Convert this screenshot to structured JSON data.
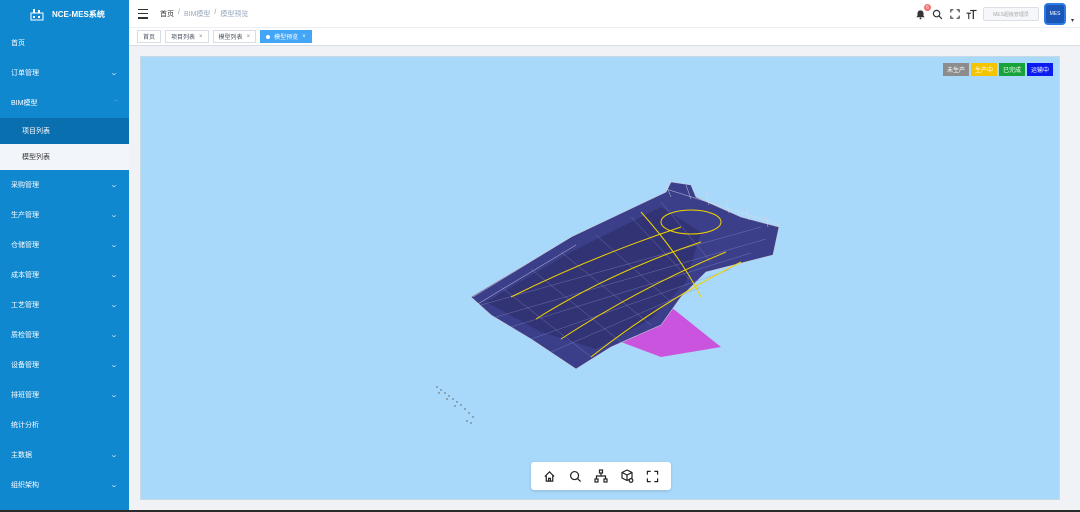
{
  "app": {
    "title": "NCE-MES系统"
  },
  "sidebar": {
    "items": [
      {
        "label": "首页",
        "has_children": false
      },
      {
        "label": "订单管理",
        "has_children": true
      },
      {
        "label": "BIM模型",
        "has_children": true,
        "expanded": true,
        "children": [
          {
            "label": "项目列表"
          },
          {
            "label": "模型列表"
          }
        ]
      },
      {
        "label": "采购管理",
        "has_children": true
      },
      {
        "label": "生产管理",
        "has_children": true
      },
      {
        "label": "仓储管理",
        "has_children": true
      },
      {
        "label": "成本管理",
        "has_children": true
      },
      {
        "label": "工艺管理",
        "has_children": true
      },
      {
        "label": "质检管理",
        "has_children": true
      },
      {
        "label": "设备管理",
        "has_children": true
      },
      {
        "label": "排班管理",
        "has_children": true
      },
      {
        "label": "统计分析",
        "has_children": false
      },
      {
        "label": "主数据",
        "has_children": true
      },
      {
        "label": "组织架构",
        "has_children": true
      }
    ]
  },
  "breadcrumb": {
    "items": [
      "首页",
      "BIM模型",
      "模型预览"
    ],
    "separator": "/"
  },
  "header": {
    "notification_count": "6",
    "user_label": "MES超级管理员",
    "avatar_text": "MES"
  },
  "tags": [
    {
      "label": "首页",
      "closable": false,
      "active": false
    },
    {
      "label": "项目列表",
      "closable": true,
      "active": false
    },
    {
      "label": "模型列表",
      "closable": true,
      "active": false
    },
    {
      "label": "模型预览",
      "closable": true,
      "active": true
    }
  ],
  "status_legend": [
    {
      "label": "未生产",
      "color": "#8c8c8c"
    },
    {
      "label": "生产中",
      "color": "#f5c400"
    },
    {
      "label": "已完成",
      "color": "#18a33a"
    },
    {
      "label": "运输中",
      "color": "#0a1cf0"
    }
  ],
  "viewer_toolbar": [
    {
      "icon": "home-icon"
    },
    {
      "icon": "search-icon"
    },
    {
      "icon": "model-tree-icon"
    },
    {
      "icon": "properties-cube-icon"
    },
    {
      "icon": "fullscreen-icon"
    }
  ],
  "colors": {
    "sidebar_bg": "#1088d0",
    "viewer_bg": "#a9d9fa",
    "active_tag": "#42a5f5"
  }
}
